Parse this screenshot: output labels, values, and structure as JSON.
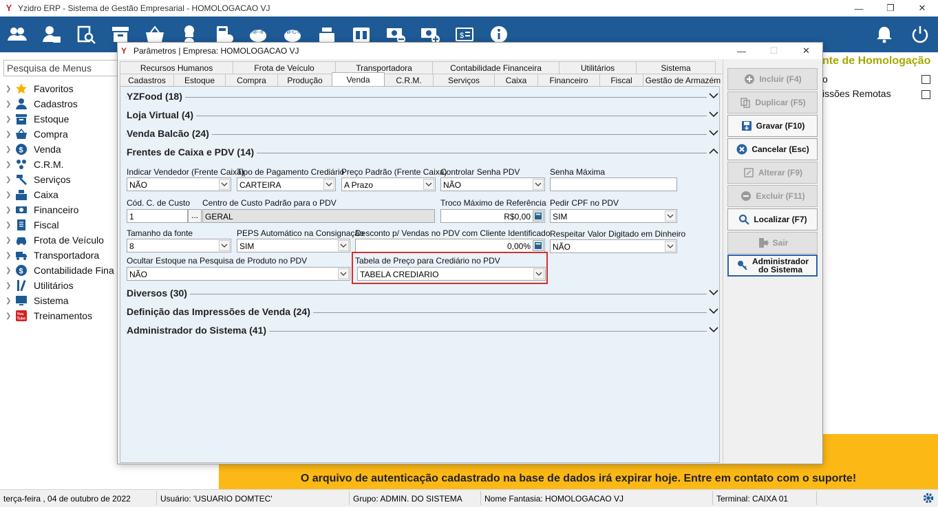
{
  "window": {
    "title": "Yzidro ERP - Sistema de Gestão Empresarial - HOMOLOGACAO VJ",
    "logo": "Y",
    "minimize": "—",
    "maximize": "❐",
    "close": "✕"
  },
  "toolbar": {
    "icons": [
      "users-icon",
      "user-card-icon",
      "search-document-icon",
      "box-icon",
      "basket-icon",
      "chef-icon",
      "calculator-document-icon",
      "nfe-icon",
      "nfce-icon",
      "cash-register-icon",
      "calendar-icon",
      "money-remove-icon",
      "money-add-icon",
      "money-doc-icon",
      "info-icon"
    ],
    "right_icons": [
      "bell-icon",
      "power-icon"
    ]
  },
  "sidebar": {
    "search_placeholder": "Pesquisa de Menus",
    "items": [
      {
        "label": "Favoritos",
        "icon": "star-icon"
      },
      {
        "label": "Cadastros",
        "icon": "user-icon"
      },
      {
        "label": "Estoque",
        "icon": "box-icon"
      },
      {
        "label": "Compra",
        "icon": "basket-icon"
      },
      {
        "label": "Venda",
        "icon": "dollar-icon"
      },
      {
        "label": "C.R.M.",
        "icon": "crm-icon"
      },
      {
        "label": "Serviços",
        "icon": "hammer-icon"
      },
      {
        "label": "Caixa",
        "icon": "cash-register-icon"
      },
      {
        "label": "Financeiro",
        "icon": "money-icon"
      },
      {
        "label": "Fiscal",
        "icon": "document-icon"
      },
      {
        "label": "Frota de Veículo",
        "icon": "car-icon"
      },
      {
        "label": "Transportadora",
        "icon": "truck-icon"
      },
      {
        "label": "Contabilidade Fina",
        "icon": "accounting-icon"
      },
      {
        "label": "Utilitários",
        "icon": "tools-icon"
      },
      {
        "label": "Sistema",
        "icon": "monitor-icon"
      },
      {
        "label": "Treinamentos",
        "icon": "youtube-icon"
      }
    ]
  },
  "background": {
    "homolog_title": "nte de Homologação",
    "p_text": "o",
    "remote_text": "issões Remotas",
    "banner_message": "O arquivo de autenticação cadastrado na base de dados irá expirar hoje. Entre em contato com o suporte!"
  },
  "statusbar": {
    "date": "terça-feira ,  04  de  outubro  de  2022",
    "user": "Usuário: 'USUARIO DOMTEC'",
    "group": "Grupo: ADMIN. DO SISTEMA",
    "fantasy": "Nome Fantasia: HOMOLOGACAO VJ",
    "terminal": "Terminal: CAIXA 01"
  },
  "dialog": {
    "title": "Parâmetros | Empresa: HOMOLOGACAO VJ",
    "tabs_row1": [
      "Recursos Humanos",
      "Frota de Veículo",
      "Transportadora",
      "Contabilidade Financeira",
      "Utilitários",
      "Sistema"
    ],
    "tabs_row2": [
      "Cadastros",
      "Estoque",
      "Compra",
      "Produção",
      "Venda",
      "C.R.M.",
      "Serviços",
      "Caixa",
      "Financeiro",
      "Fiscal",
      "Gestão de Armazém"
    ],
    "active_tab": "Venda",
    "sections": {
      "yzfood": "YZFood (18)",
      "loja": "Loja Virtual (4)",
      "balcao": "Venda Balcão (24)",
      "frentes": "Frentes de Caixa e PDV (14)",
      "diversos": "Diversos (30)",
      "impressoes": "Definição das Impressões de Venda (24)",
      "admin": "Administrador do Sistema (41)"
    },
    "fields": {
      "indicar_vendedor": {
        "label": "Indicar Vendedor (Frente Caixa)",
        "value": "NÃO"
      },
      "tipo_pagamento": {
        "label": "Tipo de Pagamento Crediário",
        "value": "CARTEIRA"
      },
      "preco_padrao": {
        "label": "Preço Padrão (Frente Caixa)",
        "value": "A Prazo"
      },
      "controlar_senha": {
        "label": "Controlar Senha PDV",
        "value": "NÃO"
      },
      "senha_maxima": {
        "label": "Senha Máxima",
        "value": ""
      },
      "cod_c_custo": {
        "label": "Cód. C. de Custo",
        "value": "1",
        "button": "..."
      },
      "centro_custo": {
        "label": "Centro de Custo Padrão para o PDV",
        "value": "GERAL"
      },
      "troco_maximo": {
        "label": "Troco Máximo de Referência",
        "value": "R$0,00"
      },
      "pedir_cpf": {
        "label": "Pedir CPF no PDV",
        "value": "SIM"
      },
      "tamanho_fonte": {
        "label": "Tamanho da fonte",
        "value": "8"
      },
      "peps": {
        "label": "PEPS Automático na Consignação",
        "value": "SIM"
      },
      "desconto": {
        "label": "Desconto p/ Vendas no PDV com Cliente Identificado",
        "value": "0,00%"
      },
      "respeitar_valor": {
        "label": "Respeitar Valor Digitado em Dinheiro",
        "value": "NÃO"
      },
      "ocultar_estoque": {
        "label": "Ocultar Estoque na Pesquisa de Produto no PDV",
        "value": "NÃO"
      },
      "tabela_preco": {
        "label": "Tabela de Preço para Crediário no PDV",
        "value": "TABELA CREDIARIO"
      }
    },
    "buttons": {
      "incluir": "Incluir (F4)",
      "duplicar": "Duplicar (F5)",
      "gravar": "Gravar (F10)",
      "cancelar": "Cancelar (Esc)",
      "alterar": "Alterar (F9)",
      "excluir": "Excluir (F11)",
      "localizar": "Localizar (F7)",
      "sair": "Sair",
      "admin_line1": "Administrador",
      "admin_line2": "do Sistema"
    }
  },
  "colors": {
    "toolbar": "#1e5a96",
    "banner": "#fcb814",
    "highlight": "#d32f2f",
    "homolog_title": "#a8a800"
  }
}
